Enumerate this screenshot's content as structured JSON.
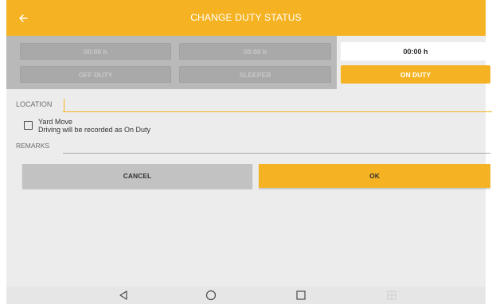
{
  "app_bar": {
    "title": "CHANGE DUTY STATUS",
    "back_icon": "arrow-left-icon",
    "color": "#f5b324"
  },
  "duty_status": {
    "options": [
      {
        "time": "00:00 h",
        "label": "OFF DUTY",
        "selected": false
      },
      {
        "time": "00:00 h",
        "label": "SLEEPER",
        "selected": false
      },
      {
        "time": "00:00 h",
        "label": "ON DUTY",
        "selected": true
      }
    ]
  },
  "form": {
    "location_label": "LOCATION",
    "location_value": "",
    "yard_move": {
      "title": "Yard Move",
      "subtitle": "Driving will be recorded as On Duty",
      "checked": false
    },
    "remarks_label": "REMARKS",
    "remarks_value": ""
  },
  "buttons": {
    "cancel": "CANCEL",
    "ok": "OK"
  },
  "nav_bar": {
    "icons": [
      "back-triangle-icon",
      "home-circle-icon",
      "recents-square-icon",
      "split-screen-icon"
    ]
  },
  "colors": {
    "accent": "#f5b324",
    "inactive_cell": "#a9a9a9",
    "panel_grey": "#b9b9b9",
    "background": "#ececec"
  }
}
